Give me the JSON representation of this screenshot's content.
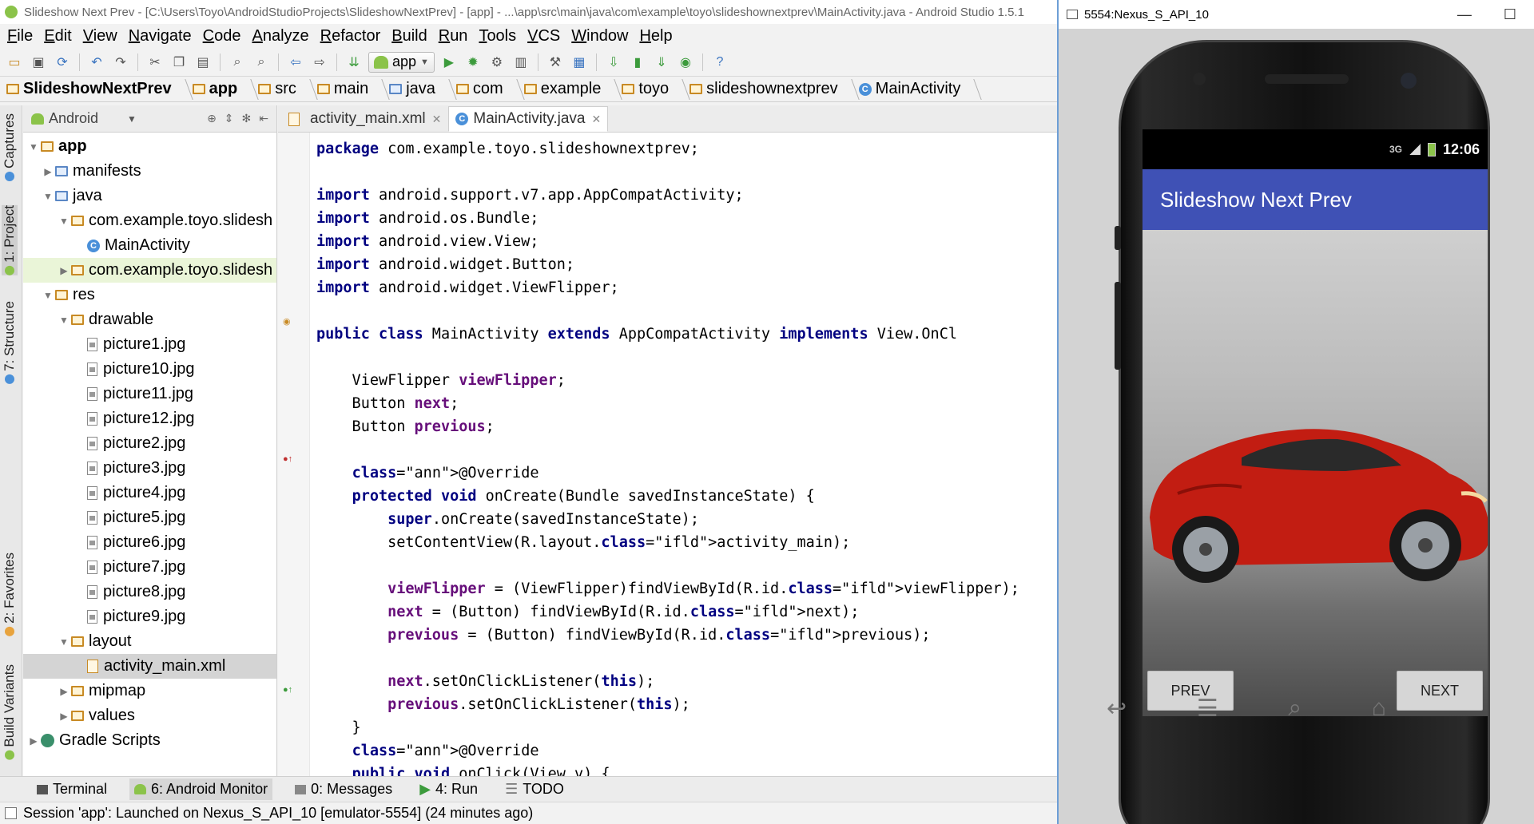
{
  "window": {
    "title": "Slideshow Next Prev - [C:\\Users\\Toyo\\AndroidStudioProjects\\SlideshowNextPrev] - [app] - ...\\app\\src\\main\\java\\com\\example\\toyo\\slideshownextprev\\MainActivity.java - Android Studio 1.5.1"
  },
  "menu": [
    "File",
    "Edit",
    "View",
    "Navigate",
    "Code",
    "Analyze",
    "Refactor",
    "Build",
    "Run",
    "Tools",
    "VCS",
    "Window",
    "Help"
  ],
  "toolbar": {
    "run_config": "app"
  },
  "breadcrumb": [
    "SlideshowNextPrev",
    "app",
    "src",
    "main",
    "java",
    "com",
    "example",
    "toyo",
    "slideshownextprev",
    "MainActivity"
  ],
  "side_tabs": {
    "captures": "Captures",
    "project": "1: Project",
    "structure": "7: Structure",
    "favorites": "2: Favorites",
    "build_variants": "Build Variants"
  },
  "project": {
    "view_mode": "Android",
    "tree": {
      "app": "app",
      "manifests": "manifests",
      "java": "java",
      "pkg1": "com.example.toyo.slidesh",
      "main_activity": "MainActivity",
      "pkg2": "com.example.toyo.slidesh",
      "res": "res",
      "drawable": "drawable",
      "pictures": [
        "picture1.jpg",
        "picture10.jpg",
        "picture11.jpg",
        "picture12.jpg",
        "picture2.jpg",
        "picture3.jpg",
        "picture4.jpg",
        "picture5.jpg",
        "picture6.jpg",
        "picture7.jpg",
        "picture8.jpg",
        "picture9.jpg"
      ],
      "layout": "layout",
      "activity_main": "activity_main.xml",
      "mipmap": "mipmap",
      "values": "values",
      "gradle": "Gradle Scripts"
    }
  },
  "editor": {
    "tabs": [
      "activity_main.xml",
      "MainActivity.java"
    ],
    "code": [
      "package com.example.toyo.slideshownextprev;",
      "",
      "import android.support.v7.app.AppCompatActivity;",
      "import android.os.Bundle;",
      "import android.view.View;",
      "import android.widget.Button;",
      "import android.widget.ViewFlipper;",
      "",
      "public class MainActivity extends AppCompatActivity implements View.OnCl",
      "",
      "    ViewFlipper viewFlipper;",
      "    Button next;",
      "    Button previous;",
      "",
      "    @Override",
      "    protected void onCreate(Bundle savedInstanceState) {",
      "        super.onCreate(savedInstanceState);",
      "        setContentView(R.layout.activity_main);",
      "",
      "        viewFlipper = (ViewFlipper)findViewById(R.id.viewFlipper);",
      "        next = (Button) findViewById(R.id.next);",
      "        previous = (Button) findViewById(R.id.previous);",
      "",
      "        next.setOnClickListener(this);",
      "        previous.setOnClickListener(this);",
      "    }",
      "    @Override",
      "    public void onClick(View v) {"
    ]
  },
  "bottom_tools": [
    "Terminal",
    "6: Android Monitor",
    "0: Messages",
    "4: Run",
    "TODO"
  ],
  "status": "Session 'app': Launched on Nexus_S_API_10 [emulator-5554] (24 minutes ago)",
  "emulator": {
    "title": "5554:Nexus_S_API_10",
    "time": "12:06",
    "app_title": "Slideshow Next Prev",
    "prev": "PREV",
    "next": "NEXT",
    "appbar_color": "#3f51b5"
  }
}
